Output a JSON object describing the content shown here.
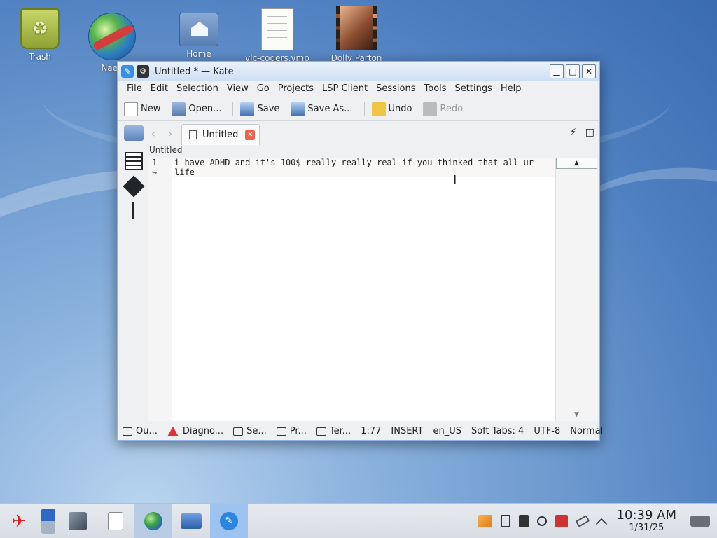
{
  "desktop": {
    "icons": [
      {
        "label": "Trash"
      },
      {
        "label": "Naen"
      },
      {
        "label": "Home"
      },
      {
        "label": "vlc-coders.vmp"
      },
      {
        "label": "Dolly Parton"
      }
    ]
  },
  "window": {
    "title": "Untitled * — Kate",
    "menu": [
      "File",
      "Edit",
      "Selection",
      "View",
      "Go",
      "Projects",
      "LSP Client",
      "Sessions",
      "Tools",
      "Settings",
      "Help"
    ],
    "toolbar": {
      "new": "New",
      "open": "Open...",
      "save": "Save",
      "save_as": "Save As...",
      "undo": "Undo",
      "redo": "Redo"
    },
    "tab": {
      "label": "Untitled"
    },
    "document_title": "Untitled",
    "editor": {
      "line_number": "1",
      "wrap_marker": "↪",
      "line1": "i have ADHD and it's 100$ really really real if you thinked that all ur",
      "line2": "life"
    },
    "statusbar": {
      "output": "Ou...",
      "diagnostics": "Diagno...",
      "search": "Se...",
      "projects": "Pr...",
      "terminal": "Ter...",
      "cursor_position": "1:77",
      "mode": "INSERT",
      "language": "en_US",
      "indentation": "Soft Tabs: 4",
      "encoding": "UTF-8",
      "syntax": "Normal"
    }
  },
  "taskbar": {
    "time": "10:39 AM",
    "date": "1/31/25"
  }
}
